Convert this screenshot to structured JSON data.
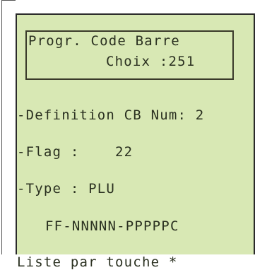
{
  "screen": {
    "title_line1": "Progr. Code Barre",
    "title_line2": "Choix :251",
    "definition": "-Definition CB Num: 2",
    "flag": "-Flag :    22",
    "type": "-Type : PLU",
    "format": "FF-NNNNN-PPPPPC",
    "list_hint": "Liste par touche *"
  }
}
